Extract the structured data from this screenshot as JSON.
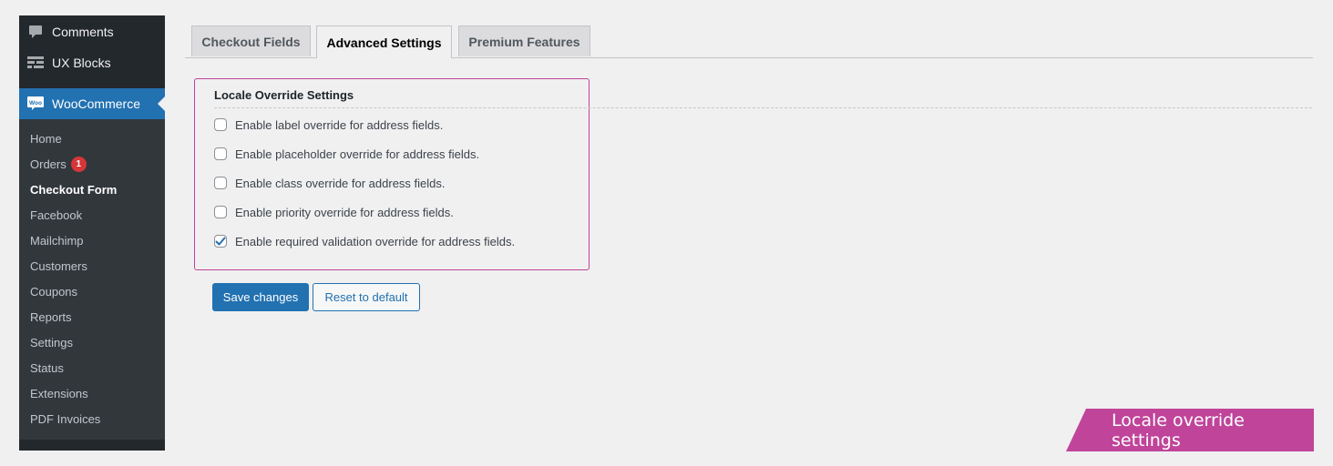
{
  "sidebar": {
    "top_items": [
      {
        "label": "Comments",
        "icon": "comment-icon"
      },
      {
        "label": "UX Blocks",
        "icon": "blocks-icon"
      }
    ],
    "woocommerce": {
      "label": "WooCommerce",
      "icon": "woo-icon",
      "icon_text": "Woo"
    },
    "submenu": [
      {
        "label": "Home"
      },
      {
        "label": "Orders",
        "badge": "1"
      },
      {
        "label": "Checkout Form",
        "active": true
      },
      {
        "label": "Facebook"
      },
      {
        "label": "Mailchimp"
      },
      {
        "label": "Customers"
      },
      {
        "label": "Coupons"
      },
      {
        "label": "Reports"
      },
      {
        "label": "Settings"
      },
      {
        "label": "Status"
      },
      {
        "label": "Extensions"
      },
      {
        "label": "PDF Invoices"
      }
    ]
  },
  "tabs": [
    {
      "label": "Checkout Fields",
      "active": false
    },
    {
      "label": "Advanced Settings",
      "active": true
    },
    {
      "label": "Premium Features",
      "active": false
    }
  ],
  "panel": {
    "title": "Locale Override Settings",
    "options": [
      {
        "label": "Enable label override for address fields.",
        "checked": false
      },
      {
        "label": "Enable placeholder override for address fields.",
        "checked": false
      },
      {
        "label": "Enable class override for address fields.",
        "checked": false
      },
      {
        "label": "Enable priority override for address fields.",
        "checked": false
      },
      {
        "label": "Enable required validation override for address fields.",
        "checked": true
      }
    ]
  },
  "buttons": {
    "save": "Save changes",
    "reset": "Reset to default"
  },
  "banner": {
    "text": "Locale override settings",
    "color": "#c0449a"
  },
  "colors": {
    "accent": "#2271b1",
    "highlight_border": "#c0449a",
    "badge": "#d63638"
  }
}
